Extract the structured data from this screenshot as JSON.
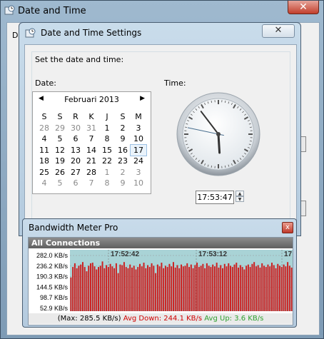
{
  "outer_window": {
    "title": "Date and Time",
    "tab_stub": "Da",
    "close_glyph": "✕"
  },
  "inner_dialog": {
    "title": "Date and Time Settings",
    "close_glyph": "✕",
    "prompt": "Set the date and time:",
    "date_label": "Date:",
    "time_label": "Time:"
  },
  "calendar": {
    "month_label": "Februari 2013",
    "prev_glyph": "◀",
    "next_glyph": "▶",
    "weekdays": [
      "S",
      "S",
      "R",
      "K",
      "J",
      "S",
      "M"
    ],
    "days": [
      [
        "28",
        "29",
        "30",
        "31",
        "1",
        "2",
        "3"
      ],
      [
        "4",
        "5",
        "6",
        "7",
        "8",
        "9",
        "10"
      ],
      [
        "11",
        "12",
        "13",
        "14",
        "15",
        "16",
        "17"
      ],
      [
        "18",
        "19",
        "20",
        "21",
        "22",
        "23",
        "24"
      ],
      [
        "25",
        "26",
        "27",
        "28",
        "1",
        "2",
        "3"
      ],
      [
        "4",
        "5",
        "6",
        "7",
        "8",
        "9",
        "10"
      ]
    ],
    "dim_cells": [
      [
        0,
        0
      ],
      [
        0,
        1
      ],
      [
        0,
        2
      ],
      [
        0,
        3
      ],
      [
        4,
        4
      ],
      [
        4,
        5
      ],
      [
        4,
        6
      ],
      [
        5,
        0
      ],
      [
        5,
        1
      ],
      [
        5,
        2
      ],
      [
        5,
        3
      ],
      [
        5,
        4
      ],
      [
        5,
        5
      ],
      [
        5,
        6
      ]
    ],
    "today_cell": [
      2,
      6
    ]
  },
  "clock": {
    "hour": 17,
    "minute": 53,
    "second": 47
  },
  "time_field": {
    "value": "17:53:47",
    "spin_up": "▲",
    "spin_down": "▼"
  },
  "bandwidth": {
    "title": "Bandwidth Meter Pro",
    "close_glyph": "x",
    "header": "All Connections",
    "y_labels": [
      "282.0 KB/s",
      "236.2 KB/s",
      "190.3 KB/s",
      "144.5 KB/s",
      "98.7 KB/s",
      "52.9 KB/s"
    ],
    "time_labels": [
      "17:52:42",
      "17:53:12",
      "17"
    ],
    "max_text": "(Max: 285.5 KB/s)",
    "avg_down_text": "Avg Down: 244.1 KB/s",
    "avg_up_text": "Avg Up: 3.6 KB/s",
    "colors": {
      "bar": "#cc1f1f",
      "avg_down": "#d00000",
      "avg_up": "#2fa02f",
      "chart_bg": "#a9d3d6"
    },
    "bar_levels": [
      0.55,
      0.72,
      0.78,
      0.7,
      0.74,
      0.76,
      0.8,
      0.72,
      0.65,
      0.74,
      0.78,
      0.79,
      0.73,
      0.68,
      0.72,
      0.74,
      0.81,
      0.7,
      0.75,
      0.72,
      0.77,
      0.73,
      0.7,
      0.78,
      0.62,
      0.76,
      0.75,
      0.8,
      0.72,
      0.7,
      0.76,
      0.71,
      0.74,
      0.68,
      0.72,
      0.77,
      0.73,
      0.79,
      0.7,
      0.75,
      0.72,
      0.78,
      0.74,
      0.62,
      0.76,
      0.73,
      0.79,
      0.7,
      0.74,
      0.72,
      0.77,
      0.73,
      0.8,
      0.71,
      0.75,
      0.7,
      0.76,
      0.73,
      0.74,
      0.78,
      0.72,
      0.76,
      0.7,
      0.75,
      0.79,
      0.72,
      0.74,
      0.77,
      0.7,
      0.78,
      0.74,
      0.72,
      0.76,
      0.73,
      0.79,
      0.71,
      0.75,
      0.7,
      0.77,
      0.73,
      0.78,
      0.74,
      0.72,
      0.76,
      0.79,
      0.71,
      0.75,
      0.72,
      0.68,
      0.74,
      0.76,
      0.72,
      0.77,
      0.8,
      0.73,
      0.75,
      0.71,
      0.78,
      0.74,
      0.72,
      0.76,
      0.73,
      0.79,
      0.75,
      0.7,
      0.77,
      0.74,
      0.72,
      0.76,
      0.73,
      0.8,
      0.74,
      0.71
    ]
  }
}
